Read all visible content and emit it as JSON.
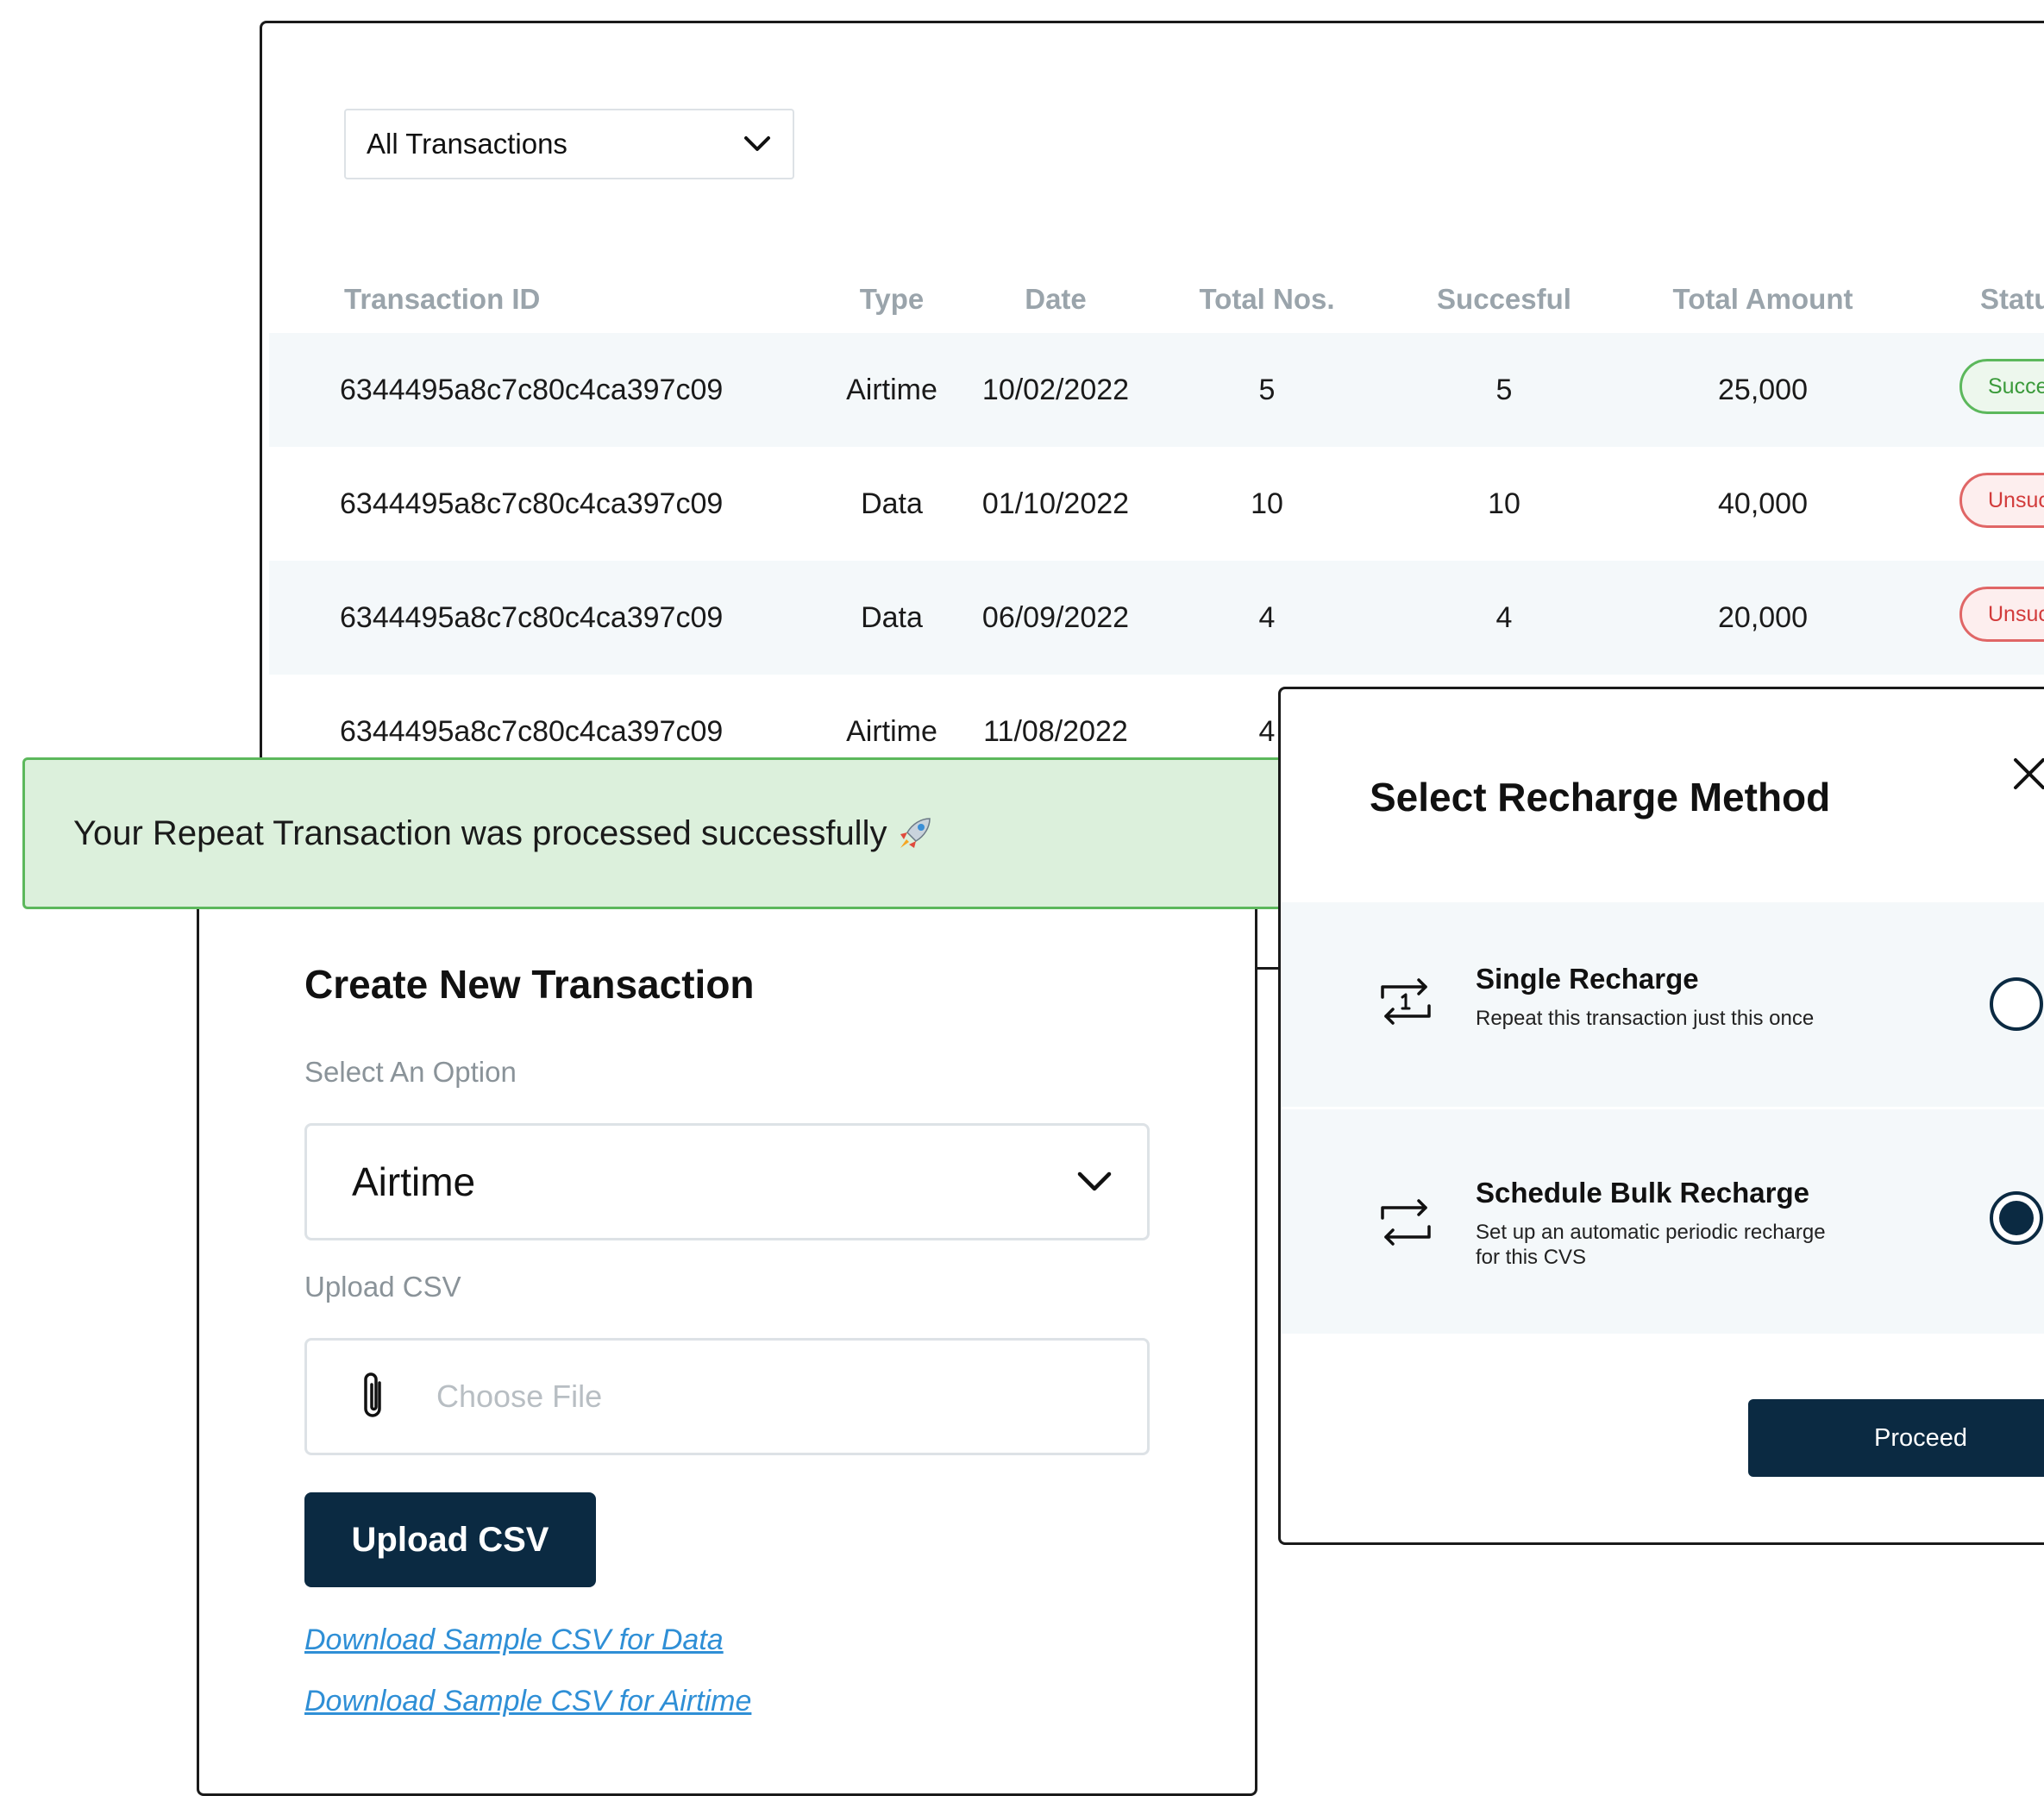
{
  "transactions": {
    "filter": {
      "selected": "All Transactions"
    },
    "columns": {
      "id": "Transaction ID",
      "type": "Type",
      "date": "Date",
      "total_nos": "Total Nos.",
      "successful": "Succesful",
      "total_amount": "Total Amount",
      "status": "Status"
    },
    "rows": [
      {
        "id": "6344495a8c7c80c4ca397c09",
        "type": "Airtime",
        "date": "10/02/2022",
        "total_nos": "5",
        "successful": "5",
        "total_amount": "25,000",
        "status": "Successful"
      },
      {
        "id": "6344495a8c7c80c4ca397c09",
        "type": "Data",
        "date": "01/10/2022",
        "total_nos": "10",
        "successful": "10",
        "total_amount": "40,000",
        "status": "Unsuccessful"
      },
      {
        "id": "6344495a8c7c80c4ca397c09",
        "type": "Data",
        "date": "06/09/2022",
        "total_nos": "4",
        "successful": "4",
        "total_amount": "20,000",
        "status": "Unsuccessful"
      },
      {
        "id": "6344495a8c7c80c4ca397c09",
        "type": "Airtime",
        "date": "11/08/2022",
        "total_nos": "4",
        "successful": "",
        "total_amount": "",
        "status": ""
      }
    ]
  },
  "toast": {
    "message": "Your Repeat Transaction was processed successfully",
    "icon": "rocket-icon"
  },
  "create": {
    "title": "Create New Transaction",
    "option_label": "Select An Option",
    "option_value": "Airtime",
    "upload_label": "Upload CSV",
    "file_placeholder": "Choose File",
    "upload_button": "Upload CSV",
    "link_data": "Download Sample CSV for Data",
    "link_airtime": "Download Sample CSV for Airtime"
  },
  "modal": {
    "title": "Select Recharge Method",
    "options": [
      {
        "title": "Single Recharge",
        "desc": "Repeat this transaction just this once",
        "selected": false,
        "icon": "repeat-once-icon"
      },
      {
        "title": "Schedule Bulk Recharge",
        "desc_line1": "Set up an automatic periodic recharge",
        "desc_line2": "for this CVS",
        "selected": true,
        "icon": "repeat-icon"
      }
    ],
    "proceed": "Proceed"
  },
  "colors": {
    "primary": "#0b2a42",
    "success_bg": "#dcf0dc",
    "success_border": "#5cb85c",
    "error": "#d23b3b",
    "link": "#2f8fd6",
    "muted": "#9aa4ab"
  }
}
